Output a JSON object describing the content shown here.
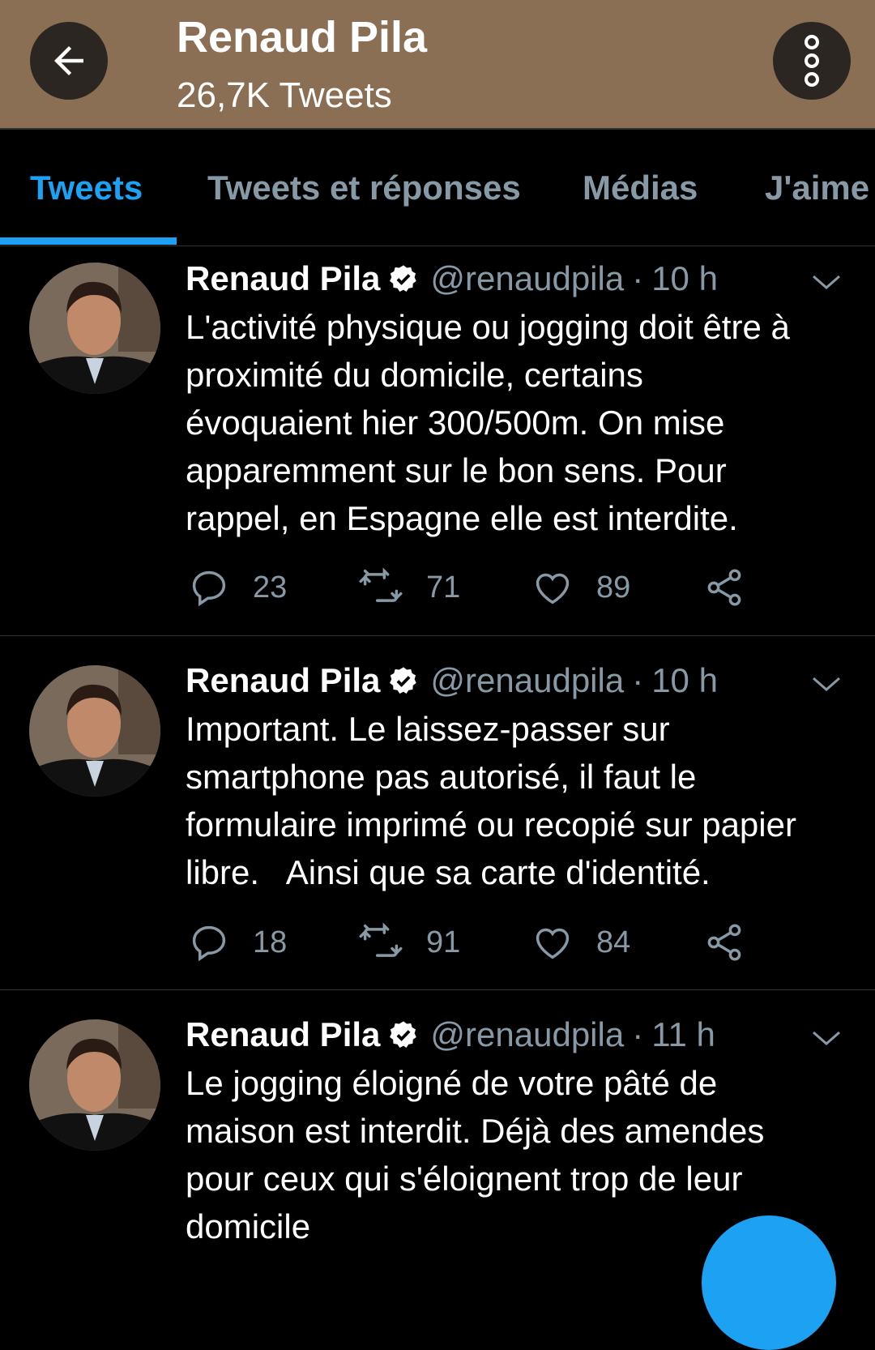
{
  "header": {
    "title": "Renaud Pila",
    "subtitle": "26,7K Tweets",
    "bg_color": "#8b6f55"
  },
  "tabs": [
    {
      "label": "Tweets",
      "active": true
    },
    {
      "label": "Tweets et réponses",
      "active": false
    },
    {
      "label": "Médias",
      "active": false
    },
    {
      "label": "J'aime",
      "active": false
    }
  ],
  "accent_color": "#1da1f2",
  "tweets": [
    {
      "name": "Renaud Pila",
      "handle": "@renaudpila",
      "sep": "·",
      "time": "10 h",
      "text": "L'activité physique ou jogging doit être à\nproximité du domicile, certains\névoquaient hier 300/500m. On mise\napparemment sur le bon sens. Pour\nrappel, en Espagne elle est interdite.",
      "replies": "23",
      "retweets": "71",
      "likes": "89"
    },
    {
      "name": "Renaud Pila",
      "handle": "@renaudpila",
      "sep": "·",
      "time": "10 h",
      "text": "Important. Le laissez-passer sur\nsmartphone pas autorisé, il faut le\nformulaire imprimé ou recopié sur papier\nlibre.   Ainsi que sa carte d'identité.",
      "replies": "18",
      "retweets": "91",
      "likes": "84"
    },
    {
      "name": "Renaud Pila",
      "handle": "@renaudpila",
      "sep": "·",
      "time": "11 h",
      "text": "Le jogging éloigné de votre pâté de\nmaison est interdit. Déjà des amendes\npour ceux qui s'éloignent trop de leur\ndomicile"
    }
  ]
}
